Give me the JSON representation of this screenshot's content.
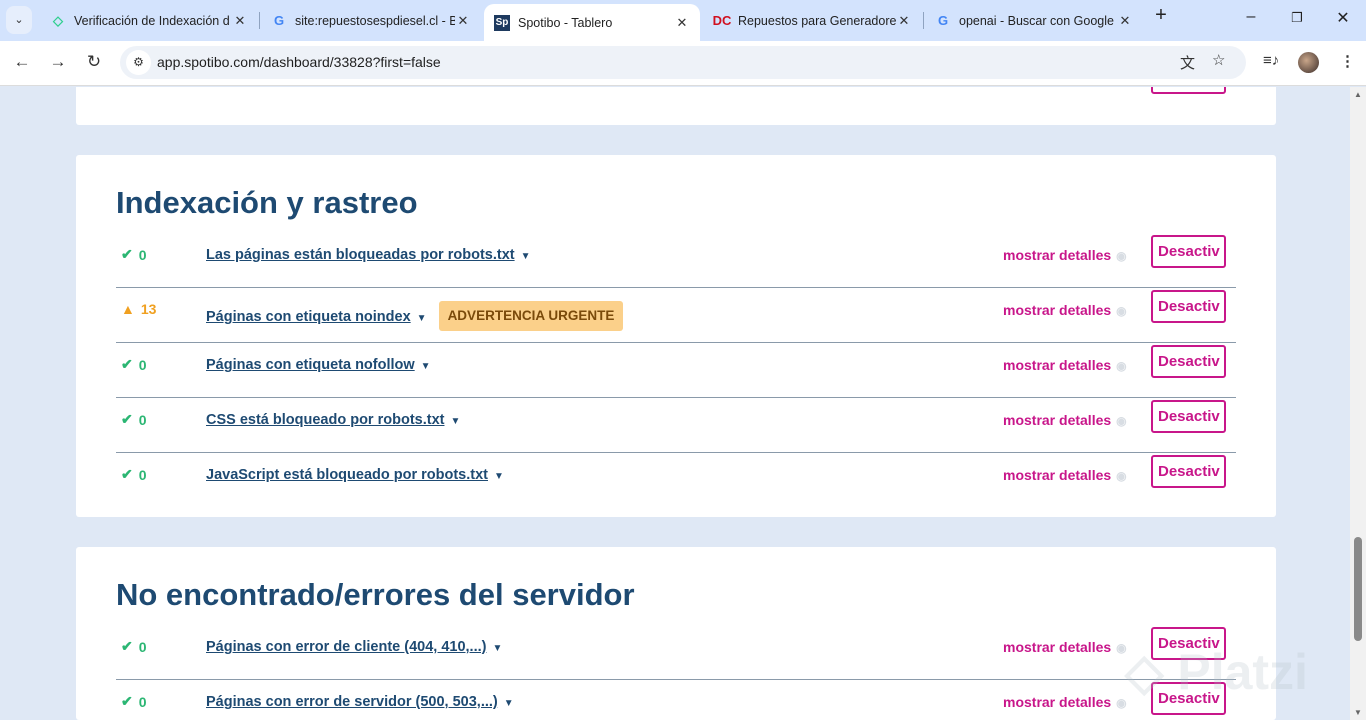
{
  "browser": {
    "tabs": [
      {
        "title": "Verificación de Indexación d",
        "favicon": "spotibo-icon",
        "active": false
      },
      {
        "title": "site:repuestosespdiesel.cl - B",
        "favicon": "google-icon",
        "active": false
      },
      {
        "title": "Spotibo - Tablero",
        "favicon": "Sp",
        "active": true
      },
      {
        "title": "Repuestos para Generadore",
        "favicon": "dc-icon",
        "active": false
      },
      {
        "title": "openai - Buscar con Google",
        "favicon": "google-icon",
        "active": false
      }
    ],
    "url": "app.spotibo.com/dashboard/33828?first=false"
  },
  "sections": [
    {
      "title": "Indexación y rastreo",
      "rows": [
        {
          "status": "ok",
          "count": "0",
          "label": "Las páginas están bloqueadas por robots.txt"
        },
        {
          "status": "warn",
          "count": "13",
          "label": "Páginas con etiqueta noindex",
          "badge": "ADVERTENCIA URGENTE"
        },
        {
          "status": "ok",
          "count": "0",
          "label": "Páginas con etiqueta nofollow"
        },
        {
          "status": "ok",
          "count": "0",
          "label": "CSS está bloqueado por robots.txt"
        },
        {
          "status": "ok",
          "count": "0",
          "label": "JavaScript está bloqueado por robots.txt"
        }
      ]
    },
    {
      "title": "No encontrado/errores del servidor",
      "rows": [
        {
          "status": "ok",
          "count": "0",
          "label": "Páginas con error de cliente (404, 410,...)"
        },
        {
          "status": "ok",
          "count": "0",
          "label": "Páginas con error de servidor (500, 503,...)"
        }
      ]
    }
  ],
  "common": {
    "details": "mostrar detalles",
    "deactivate": "Desactiv"
  },
  "watermark": "Platzi",
  "colors": {
    "accent": "#c8168a",
    "heading": "#1e4a72",
    "ok": "#2bb673",
    "warn": "#f0a020",
    "badge_bg": "#fbd08a"
  }
}
